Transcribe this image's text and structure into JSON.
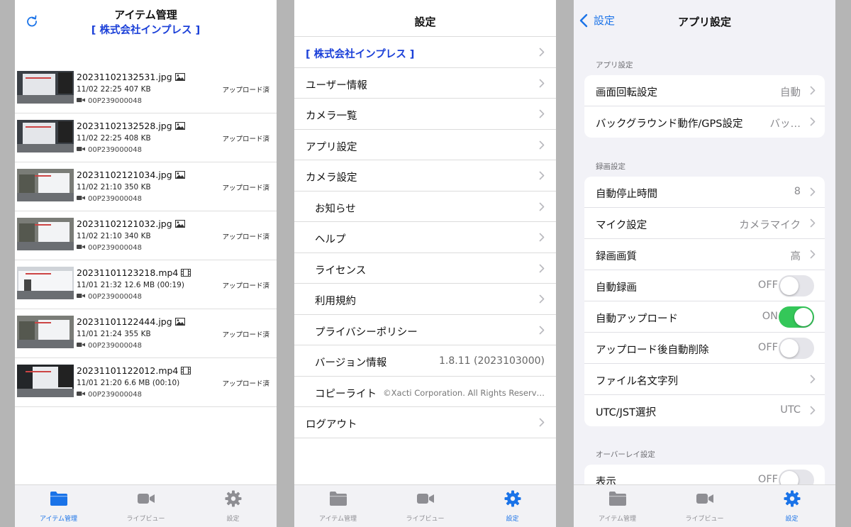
{
  "colors": {
    "accent": "#1a73e8",
    "company": "#1a3fd8",
    "toggle_on": "#34c759",
    "inactive": "#8e8e93"
  },
  "tabs": [
    {
      "label": "アイテム管理",
      "icon": "folder-icon"
    },
    {
      "label": "ライブビュー",
      "icon": "video-camera-icon"
    },
    {
      "label": "設定",
      "icon": "gear-icon"
    }
  ],
  "items_screen": {
    "title": "アイテム管理",
    "company": "[ 株式会社インプレス ]",
    "items": [
      {
        "filename": "20231102132531.jpg",
        "type": "image",
        "meta": "11/02 22:25 407 KB",
        "camera": "00P239000048",
        "status": "アップロード済"
      },
      {
        "filename": "20231102132528.jpg",
        "type": "image",
        "meta": "11/02 22:25 408 KB",
        "camera": "00P239000048",
        "status": "アップロード済"
      },
      {
        "filename": "20231102121034.jpg",
        "type": "image",
        "meta": "11/02 21:10 350 KB",
        "camera": "00P239000048",
        "status": "アップロード済"
      },
      {
        "filename": "20231102121032.jpg",
        "type": "image",
        "meta": "11/02 21:10 340 KB",
        "camera": "00P239000048",
        "status": "アップロード済"
      },
      {
        "filename": "20231101123218.mp4",
        "type": "video",
        "meta": "11/01 21:32 12.6 MB (00:19)",
        "camera": "00P239000048",
        "status": "アップロード済"
      },
      {
        "filename": "20231101122444.jpg",
        "type": "image",
        "meta": "11/01 21:24 355 KB",
        "camera": "00P239000048",
        "status": "アップロード済"
      },
      {
        "filename": "20231101122012.mp4",
        "type": "video",
        "meta": "11/01 21:20 6.6 MB (00:10)",
        "camera": "00P239000048",
        "status": "アップロード済"
      }
    ]
  },
  "settings_screen": {
    "title": "設定",
    "rows": [
      {
        "label": "[ 株式会社インプレス ]",
        "style": "company",
        "value": ""
      },
      {
        "label": "ユーザー情報",
        "style": "top",
        "value": ""
      },
      {
        "label": "カメラ一覧",
        "style": "top",
        "value": ""
      },
      {
        "label": "アプリ設定",
        "style": "top",
        "value": ""
      },
      {
        "label": "カメラ設定",
        "style": "top",
        "value": ""
      },
      {
        "label": "お知らせ",
        "style": "sub",
        "value": ""
      },
      {
        "label": "ヘルプ",
        "style": "sub",
        "value": ""
      },
      {
        "label": "ライセンス",
        "style": "sub",
        "value": ""
      },
      {
        "label": "利用規約",
        "style": "sub",
        "value": ""
      },
      {
        "label": "プライバシーポリシー",
        "style": "sub",
        "value": ""
      },
      {
        "label": "バージョン情報",
        "style": "sub",
        "value": "1.8.11 (2023103000)"
      },
      {
        "label": "コピーライト",
        "style": "sub",
        "value": "©Xacti Corporation. All Rights Reserv…"
      },
      {
        "label": "ログアウト",
        "style": "top",
        "value": ""
      }
    ]
  },
  "app_settings_screen": {
    "back_label": "設定",
    "title": "アプリ設定",
    "sections": [
      {
        "header": "アプリ設定",
        "rows": [
          {
            "label": "画面回転設定",
            "value": "自動",
            "control": "chevron"
          },
          {
            "label": "バックグラウンド動作/GPS設定",
            "value": "バッ…",
            "control": "chevron"
          }
        ]
      },
      {
        "header": "録画設定",
        "rows": [
          {
            "label": "自動停止時間",
            "value": "8",
            "control": "chevron"
          },
          {
            "label": "マイク設定",
            "value": "カメラマイク",
            "control": "chevron"
          },
          {
            "label": "録画画質",
            "value": "高",
            "control": "chevron"
          },
          {
            "label": "自動録画",
            "value": "OFF",
            "control": "toggle",
            "on": false
          },
          {
            "label": "自動アップロード",
            "value": "ON",
            "control": "toggle",
            "on": true
          },
          {
            "label": "アップロード後自動削除",
            "value": "OFF",
            "control": "toggle",
            "on": false
          },
          {
            "label": "ファイル名文字列",
            "value": "",
            "control": "chevron"
          },
          {
            "label": "UTC/JST選択",
            "value": "UTC",
            "control": "chevron"
          }
        ]
      },
      {
        "header": "オーバーレイ設定",
        "rows": [
          {
            "label": "表示",
            "value": "OFF",
            "control": "toggle",
            "on": false
          }
        ]
      }
    ]
  }
}
